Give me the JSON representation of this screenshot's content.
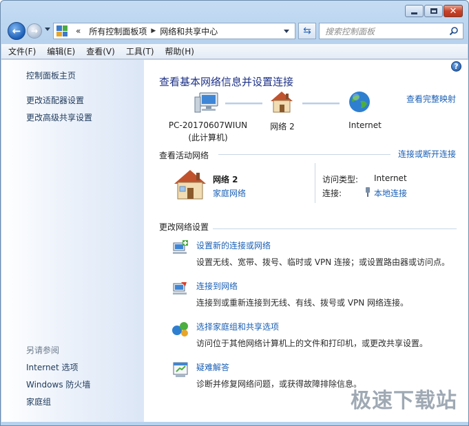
{
  "window": {
    "minimize_icon": "minimize-icon",
    "maximize_icon": "maximize-icon",
    "close_icon": "close-icon"
  },
  "address": {
    "overflow": "«",
    "crumbs": [
      "所有控制面板项",
      "网络和共享中心"
    ],
    "search_placeholder": "搜索控制面板"
  },
  "menu": [
    "文件(F)",
    "编辑(E)",
    "查看(V)",
    "工具(T)",
    "帮助(H)"
  ],
  "sidebar": {
    "links": [
      "控制面板主页",
      "更改适配器设置",
      "更改高级共享设置"
    ],
    "see_also": "另请参阅",
    "see_also_links": [
      "Internet 选项",
      "Windows 防火墙",
      "家庭组"
    ]
  },
  "main": {
    "heading": "查看基本网络信息并设置连接",
    "full_map_link": "查看完整映射",
    "map": {
      "computer_name": "PC-20170607WIUN",
      "computer_sub": "(此计算机)",
      "network_name": "网络  2",
      "internet": "Internet"
    },
    "active": {
      "title": "查看活动网络",
      "connect_link": "连接或断开连接",
      "network_name": "网络  2",
      "network_type": "家庭网络",
      "access_label": "访问类型:",
      "access_value": "Internet",
      "connections_label": "连接:",
      "connections_value": "本地连接"
    },
    "change": {
      "title": "更改网络设置",
      "tasks": [
        {
          "title": "设置新的连接或网络",
          "desc": "设置无线、宽带、拨号、临时或 VPN 连接；或设置路由器或访问点。"
        },
        {
          "title": "连接到网络",
          "desc": "连接到或重新连接到无线、有线、拨号或 VPN 网络连接。"
        },
        {
          "title": "选择家庭组和共享选项",
          "desc": "访问位于其他网络计算机上的文件和打印机，或更改共享设置。"
        },
        {
          "title": "疑难解答",
          "desc": "诊断并修复网络问题，或获得故障排除信息。"
        }
      ]
    }
  },
  "watermark": "极速下载站",
  "colors": {
    "link": "#1a5fb4",
    "heading": "#1e3287",
    "sidebar_text": "#1e395b"
  }
}
